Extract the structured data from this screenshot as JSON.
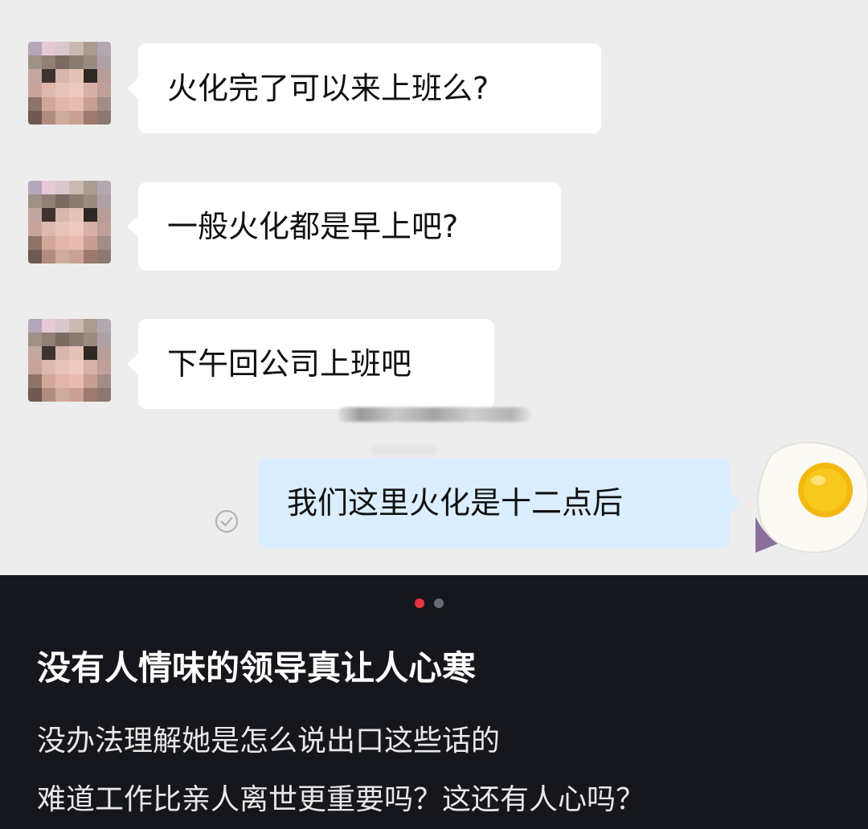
{
  "chat": {
    "messages": [
      {
        "direction": "in",
        "text": "火化完了可以来上班么?"
      },
      {
        "direction": "in",
        "text": "一般火化都是早上吧?"
      },
      {
        "direction": "in",
        "text": "下午回公司上班吧"
      },
      {
        "direction": "out",
        "text": "我们这里火化是十二点后"
      }
    ],
    "read_status_icon": "check-circle-icon",
    "sender_avatar": "pixelated-avatar",
    "self_avatar": "fried-egg-avatar"
  },
  "overlay": {
    "carousel": {
      "active_color": "#e8343f",
      "inactive_color": "#666a72",
      "count": 2,
      "active_index": 0
    },
    "title": "没有人情味的领导真让人心寒",
    "lines": [
      "没办法理解她是怎么说出口这些话的",
      "难道工作比亲人离世更重要吗？这还有人心吗？"
    ]
  },
  "colors": {
    "chat_background": "#ededed",
    "incoming_bubble": "#ffffff",
    "outgoing_bubble": "#dbeeff",
    "overlay_background": "#16171c"
  }
}
